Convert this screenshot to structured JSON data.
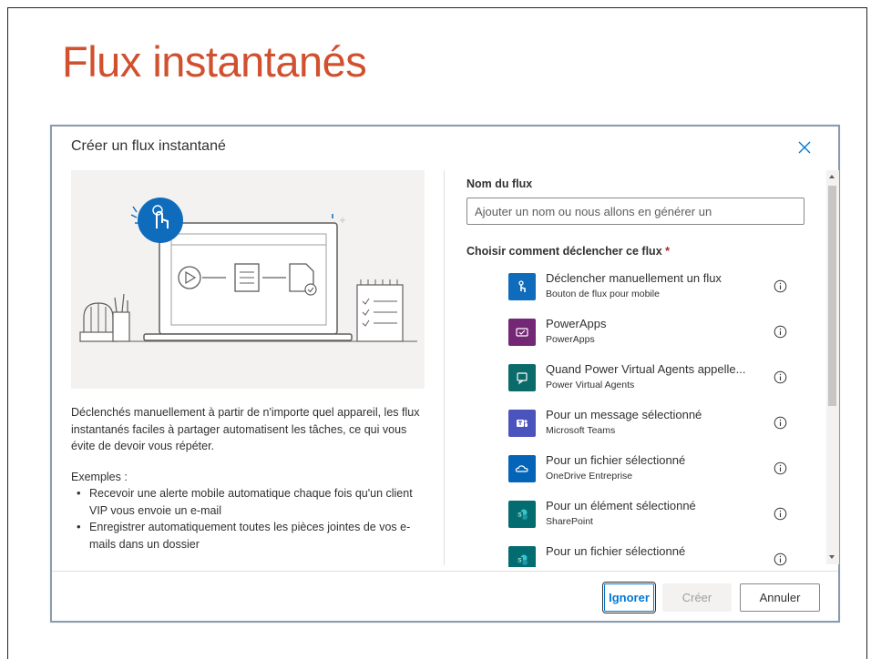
{
  "slide": {
    "title": "Flux instantanés"
  },
  "dialog": {
    "title": "Créer un flux instantané",
    "description": "Déclenchés manuellement à partir de n'importe quel appareil, les flux instantanés faciles à partager automatisent les tâches, ce qui vous évite de devoir vous répéter.",
    "examples_title": "Exemples :",
    "examples": [
      "Recevoir une alerte mobile automatique chaque fois qu'un client VIP vous envoie un e-mail",
      "Enregistrer automatiquement toutes les pièces jointes de vos e-mails dans un dossier"
    ],
    "flow_name_label": "Nom du flux",
    "flow_name_placeholder": "Ajouter un nom ou nous allons en générer un",
    "flow_name_value": "",
    "trigger_label": "Choisir comment déclencher ce flux",
    "required_marker": "*",
    "triggers": [
      {
        "name": "Déclencher manuellement un flux",
        "sub": "Bouton de flux pour mobile",
        "icon": "hand-touch-icon",
        "color": "#0f6cbd"
      },
      {
        "name": "PowerApps",
        "sub": "PowerApps",
        "icon": "powerapps-icon",
        "color": "#742774"
      },
      {
        "name": "Quand Power Virtual Agents appelle...",
        "sub": "Power Virtual Agents",
        "icon": "chat-bot-icon",
        "color": "#0b6a6a"
      },
      {
        "name": "Pour un message sélectionné",
        "sub": "Microsoft Teams",
        "icon": "teams-icon",
        "color": "#4b53bc"
      },
      {
        "name": "Pour un fichier sélectionné",
        "sub": "OneDrive Entreprise",
        "icon": "onedrive-icon",
        "color": "#0364b8"
      },
      {
        "name": "Pour un élément sélectionné",
        "sub": "SharePoint",
        "icon": "sharepoint-icon",
        "color": "#036c70"
      },
      {
        "name": "Pour un fichier sélectionné",
        "sub": "",
        "icon": "sharepoint-icon",
        "color": "#036c70"
      }
    ],
    "buttons": {
      "ignore": "Ignorer",
      "create": "Créer",
      "cancel": "Annuler"
    }
  }
}
